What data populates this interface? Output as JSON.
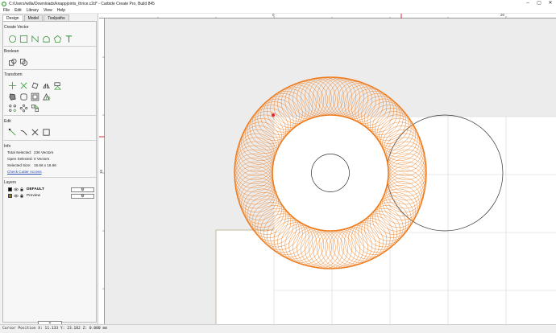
{
  "window": {
    "title": "C:/Users/willa/Downloads/knappjoints_thrice.c2d* - Carbide Create Pro, Build 845",
    "minimize": "–",
    "maximize": "▢",
    "close": "✕"
  },
  "menu": [
    "File",
    "Edit",
    "Library",
    "View",
    "Help"
  ],
  "tabs": [
    "Design",
    "Model",
    "Toolpaths"
  ],
  "sections": {
    "create_vector": "Create Vector",
    "boolean": "Boolean",
    "transform": "Transform",
    "edit": "Edit",
    "info": "Info",
    "layers": "Layers"
  },
  "info": {
    "total_selected_label": "Total Selected:",
    "total_selected_value": "236 Vectors",
    "open_selected_label": "Open Selected:",
    "open_selected_value": "0 Vectors",
    "selected_size_label": "Selected Size:",
    "selected_size_value": "16.66 x 16.66",
    "check_link": "Check Cutter Access"
  },
  "layers": [
    {
      "name": "DEFAULT",
      "color": "#000000",
      "settings": "⚙"
    },
    {
      "name": "Preview",
      "color": "#8a7a1a",
      "settings": "⚙"
    }
  ],
  "add_layer": "+",
  "rulers": {
    "top_labels": [
      "0",
      "20"
    ],
    "left_labels": [
      "10"
    ]
  },
  "status": {
    "text": "Cursor Position X: 11.133 Y: 23.182 Z: 0.000 mm"
  },
  "colors": {
    "accent_orange": "#ee7b1c",
    "ruler_marker": "#e0242c",
    "tool_green": "#3a9a3a",
    "link": "#2a4fb5"
  }
}
